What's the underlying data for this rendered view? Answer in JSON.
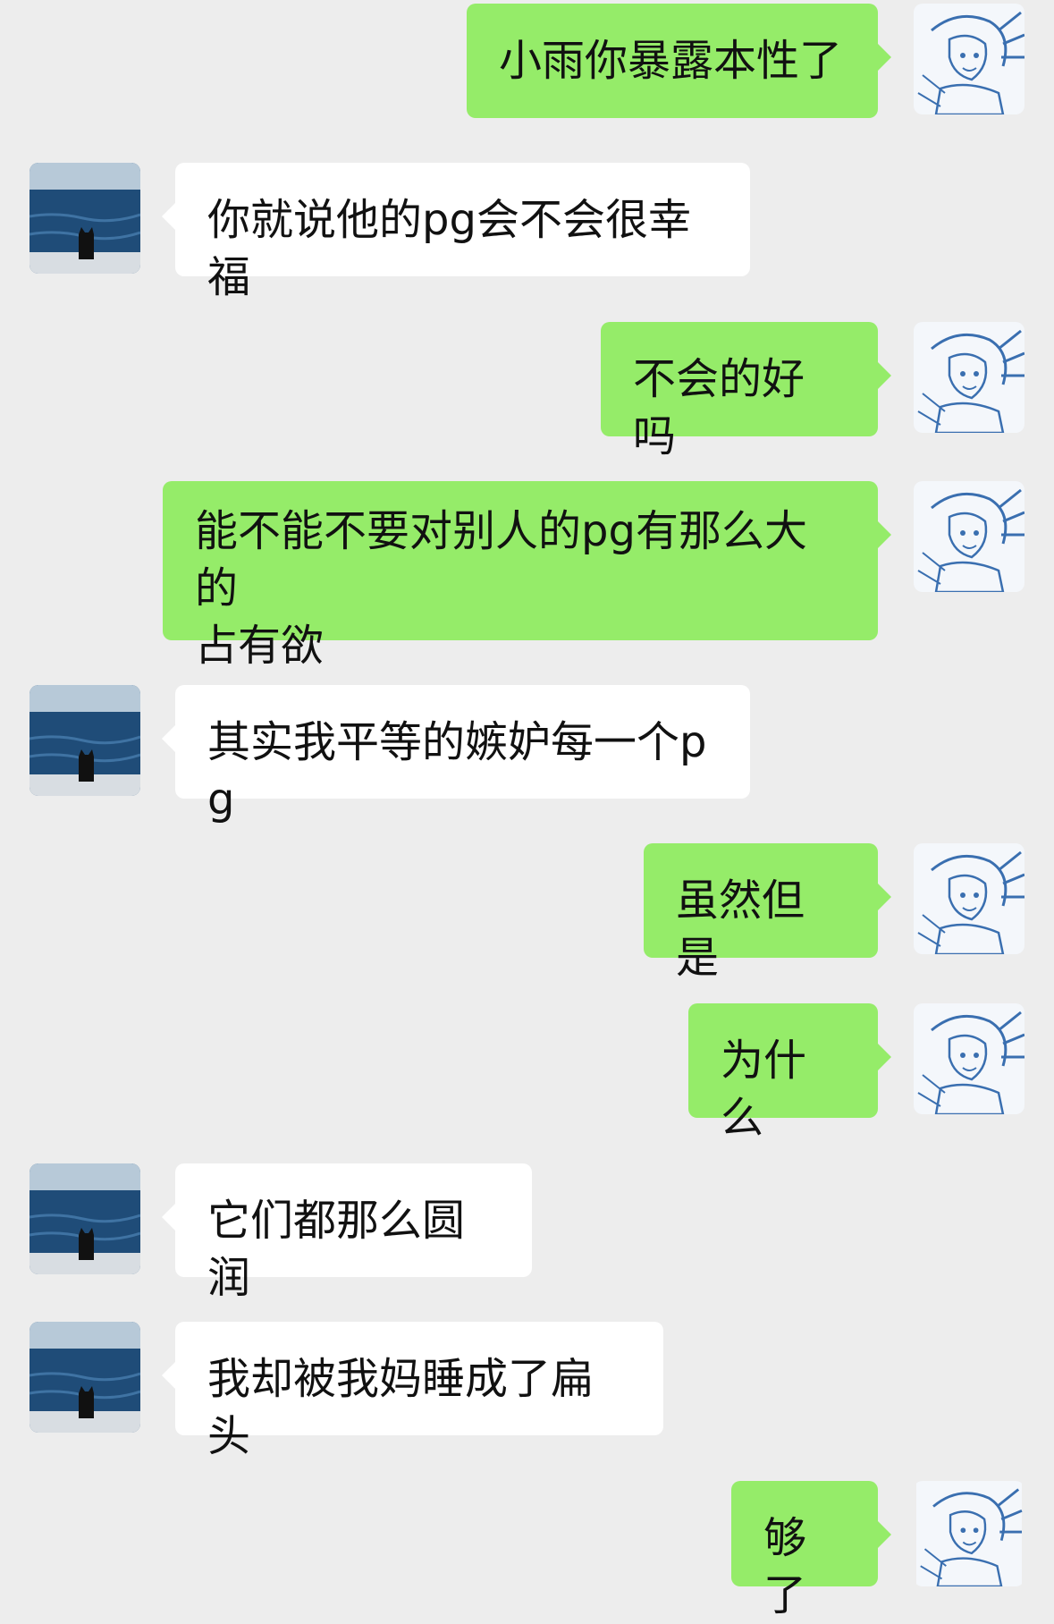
{
  "chat": {
    "avatars": {
      "self": "sketch-anime-character-avatar",
      "friend": "cat-at-sea-avatar"
    },
    "messages": [
      {
        "sender": "self",
        "text": "小雨你暴露本性了"
      },
      {
        "sender": "friend",
        "text": "你就说他的pg会不会很幸福"
      },
      {
        "sender": "self",
        "text": "不会的好吗"
      },
      {
        "sender": "self",
        "text": "能不能不要对别人的pg有那么大的\n占有欲"
      },
      {
        "sender": "friend",
        "text": "其实我平等的嫉妒每一个pg"
      },
      {
        "sender": "self",
        "text": "虽然但是"
      },
      {
        "sender": "self",
        "text": "为什么"
      },
      {
        "sender": "friend",
        "text": "它们都那么圆润"
      },
      {
        "sender": "friend",
        "text": "我却被我妈睡成了扁头"
      },
      {
        "sender": "self",
        "text": "够了"
      }
    ]
  },
  "colors": {
    "background": "#ededed",
    "self_bubble": "#95ec69",
    "friend_bubble": "#ffffff"
  }
}
